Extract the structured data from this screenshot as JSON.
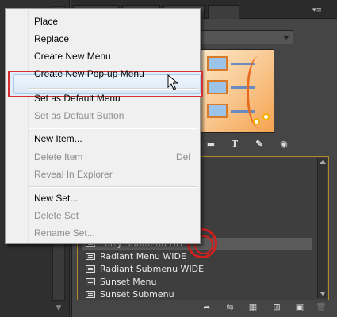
{
  "context_menu": {
    "items": [
      {
        "label": "Place",
        "enabled": true
      },
      {
        "label": "Replace",
        "enabled": true
      },
      {
        "label": "Create New Menu",
        "enabled": true
      },
      {
        "label": "Create New Pop-up Menu",
        "enabled": true,
        "highlighted": true
      },
      {
        "label": "Set as Default Menu",
        "enabled": true
      },
      {
        "label": "Set as Default Button",
        "enabled": false
      },
      {
        "label": "New Item...",
        "enabled": true
      },
      {
        "label": "Delete Item",
        "enabled": false,
        "shortcut": "Del"
      },
      {
        "label": "Reveal In Explorer",
        "enabled": false
      },
      {
        "label": "New Set...",
        "enabled": true
      },
      {
        "label": "Delete Set",
        "enabled": false
      },
      {
        "label": "Rename Set...",
        "enabled": false
      }
    ]
  },
  "menu_list": {
    "items": [
      {
        "label": "Party Submenu HD",
        "selected": true
      },
      {
        "label": "Radiant Menu WIDE"
      },
      {
        "label": "Radiant Submenu WIDE"
      },
      {
        "label": "Sunset Menu"
      },
      {
        "label": "Sunset Submenu"
      }
    ]
  },
  "panel_icons": [
    "folder-icon",
    "text-icon",
    "edit-icon",
    "eye-icon"
  ],
  "bottom_toolbar_icons": [
    "link-icon",
    "sync-icon",
    "grid-icon",
    "add-item-icon",
    "new-doc-icon",
    "trash-icon"
  ],
  "colors": {
    "menu_bg": "#f0f0f0",
    "highlight_border": "#d43030",
    "list_border": "#b08a2a",
    "panel_bg": "#454545"
  }
}
